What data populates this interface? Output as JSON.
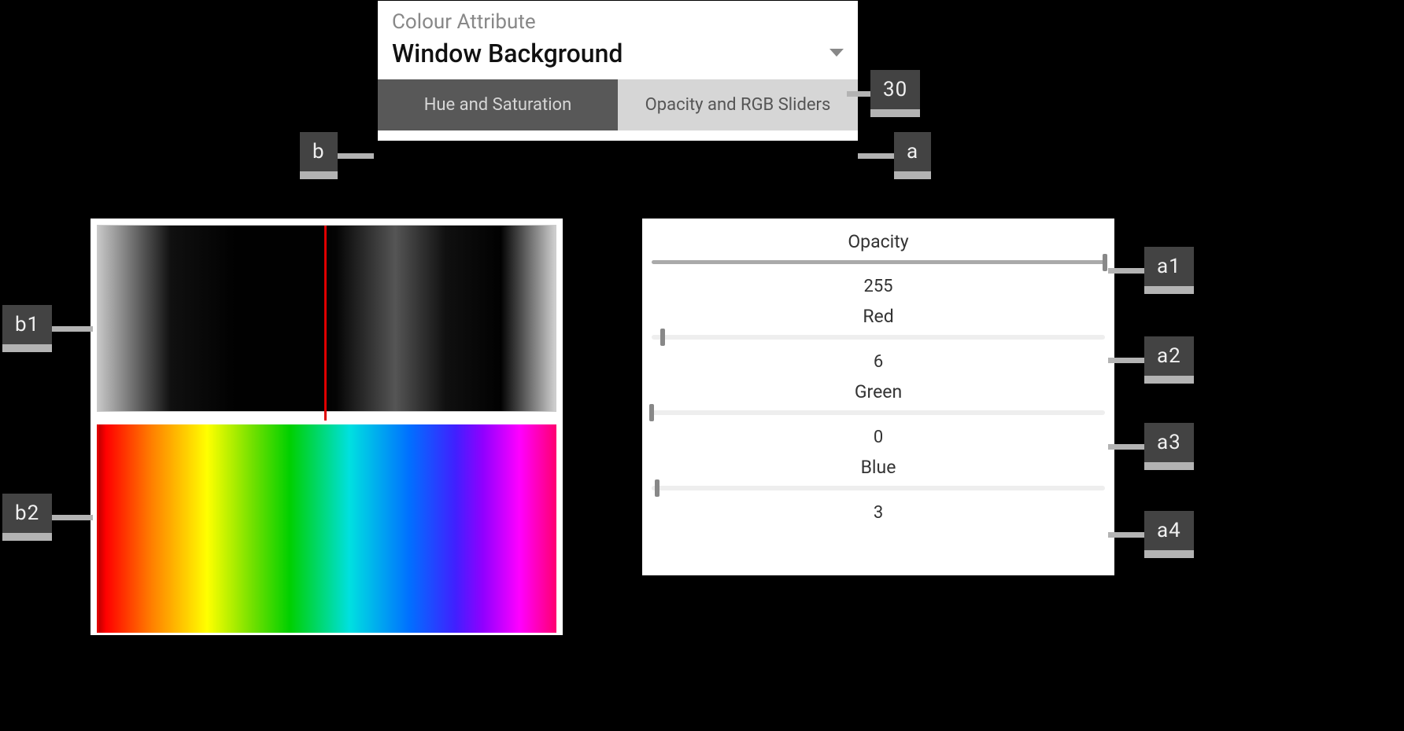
{
  "top": {
    "attr_label": "Colour Attribute",
    "attr_value": "Window Background",
    "tabs": [
      "Hue and Saturation",
      "Opacity and RGB Sliders"
    ]
  },
  "sliders": {
    "opacity": {
      "label": "Opacity",
      "value": 255,
      "max": 255
    },
    "red": {
      "label": "Red",
      "value": 6,
      "max": 255
    },
    "green": {
      "label": "Green",
      "value": 0,
      "max": 255
    },
    "blue": {
      "label": "Blue",
      "value": 3,
      "max": 255
    }
  },
  "callouts": {
    "c30": "30",
    "a": "a",
    "a1": "a1",
    "a2": "a2",
    "a3": "a3",
    "a4": "a4",
    "b": "b",
    "b1": "b1",
    "b2": "b2"
  }
}
